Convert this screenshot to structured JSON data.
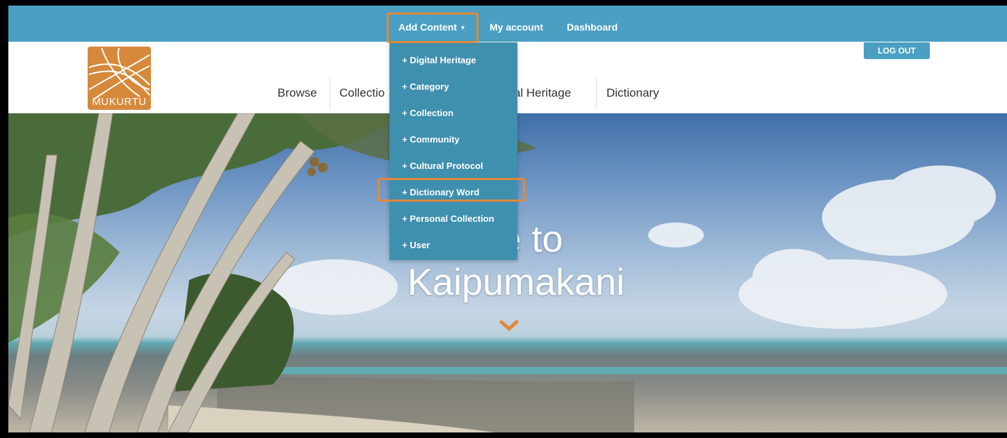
{
  "admin_bar": {
    "add_content_label": "Add Content",
    "my_account_label": "My account",
    "dashboard_label": "Dashboard",
    "color": "#4a9fc3"
  },
  "header": {
    "logo_text": "MUKURTU",
    "logo_color": "#d6893a",
    "logout_label": "LOG OUT",
    "nav": {
      "browse": "Browse",
      "collections": "Collectio",
      "digital_heritage": "gital Heritage",
      "dictionary": "Dictionary"
    }
  },
  "dropdown": {
    "items": [
      "+ Digital Heritage",
      "+ Category",
      "+ Collection",
      "+ Community",
      "+ Cultural Protocol",
      "+ Dictionary Word",
      "+ Personal Collection",
      "+ User"
    ],
    "highlighted_item": "+ Dictionary Word",
    "color": "#3f8fae"
  },
  "hero": {
    "title_line1": "me to",
    "title_line2": "Kaipumakani",
    "chevron_icon": "chevron-down-icon",
    "chevron_color": "#e2893b"
  },
  "highlight_color": "#e2893b"
}
